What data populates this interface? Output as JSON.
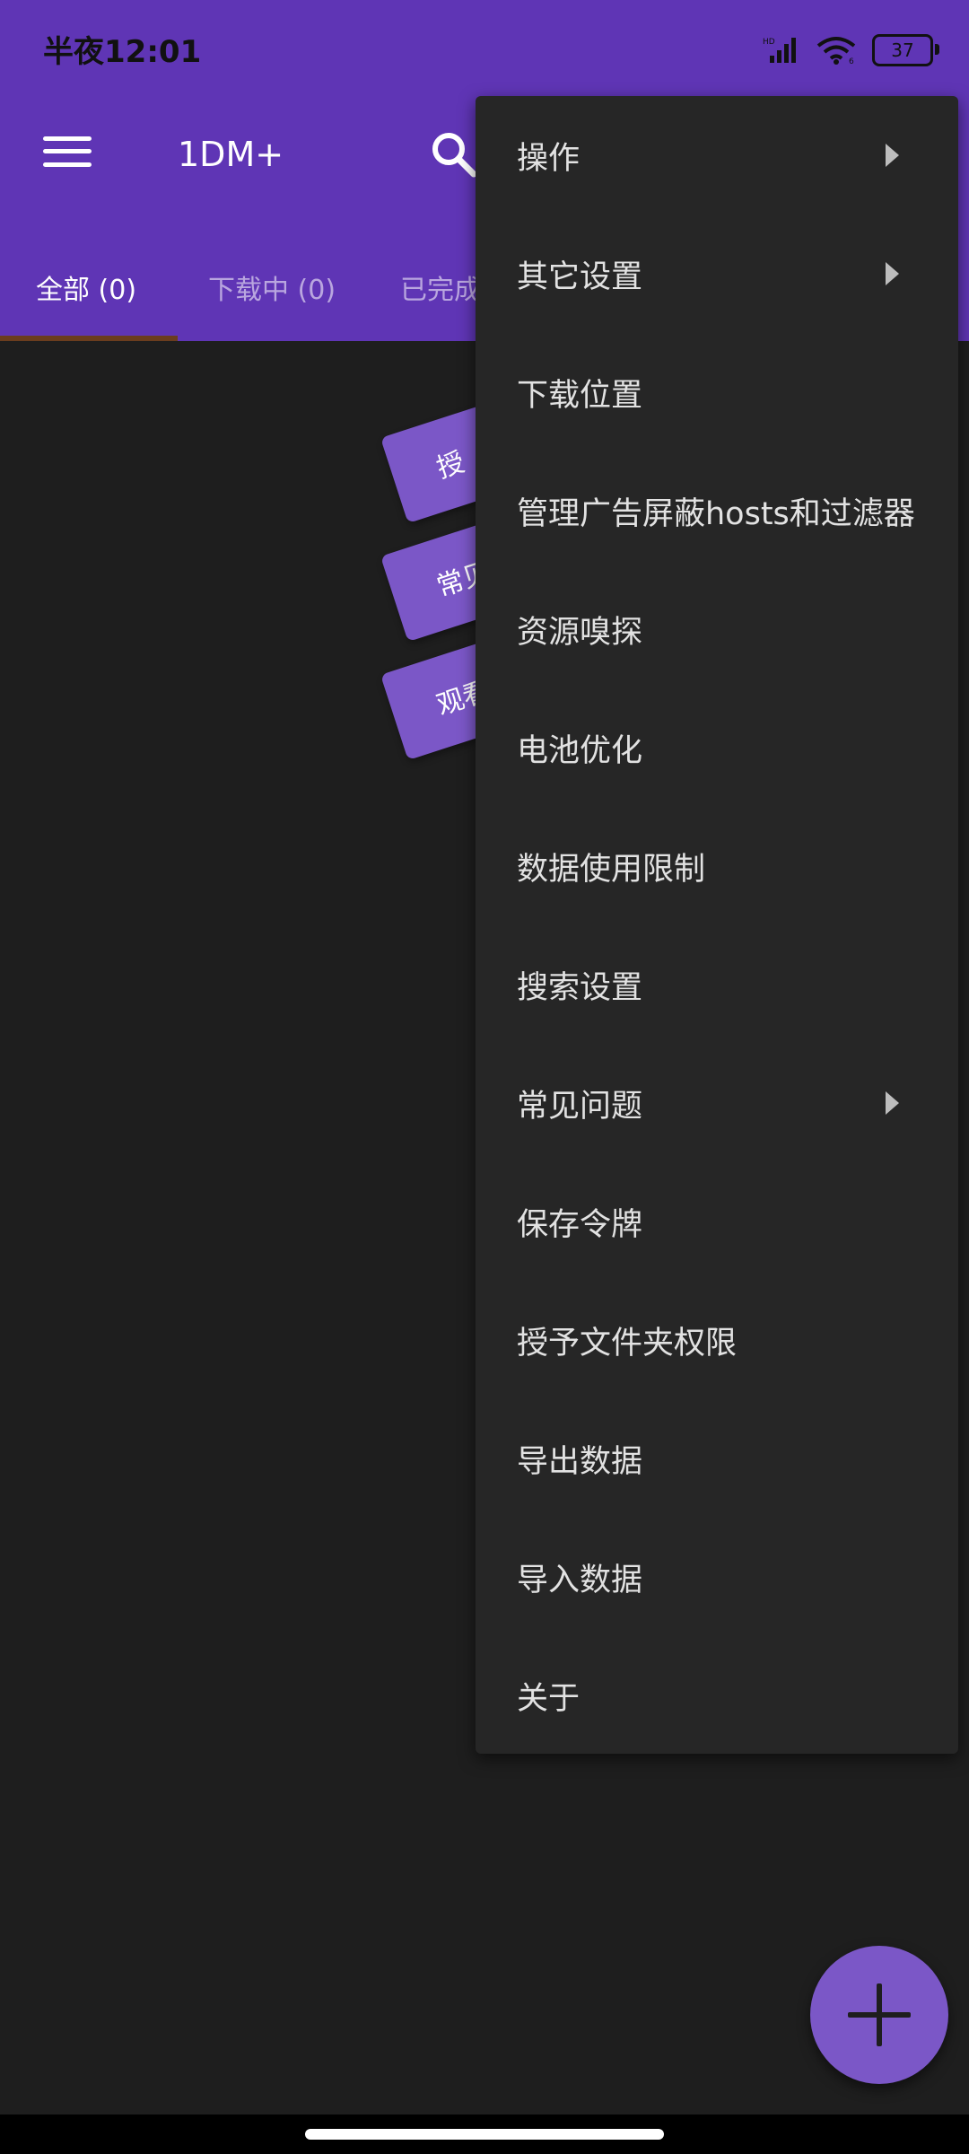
{
  "status_bar": {
    "time": "半夜12:01",
    "battery_level": "37",
    "icons": [
      "hd-signal-icon",
      "wifi-icon",
      "battery-icon"
    ]
  },
  "toolbar": {
    "app_title": "1DM+",
    "menu_icon": "hamburger-icon",
    "search_icon": "search-icon"
  },
  "tabs": [
    {
      "label": "全部 (0)"
    },
    {
      "label": "下载中 (0)"
    },
    {
      "label": "已完成"
    }
  ],
  "tips": [
    {
      "label": "授"
    },
    {
      "label": "常见"
    },
    {
      "label": "观看"
    }
  ],
  "overflow_menu": {
    "items": [
      {
        "label": "操作",
        "has_submenu": true
      },
      {
        "label": "其它设置",
        "has_submenu": true
      },
      {
        "label": "下载位置",
        "has_submenu": false
      },
      {
        "label": "管理广告屏蔽hosts和过滤器",
        "has_submenu": false
      },
      {
        "label": "资源嗅探",
        "has_submenu": false
      },
      {
        "label": "电池优化",
        "has_submenu": false
      },
      {
        "label": "数据使用限制",
        "has_submenu": false
      },
      {
        "label": "搜索设置",
        "has_submenu": false
      },
      {
        "label": "常见问题",
        "has_submenu": true
      },
      {
        "label": "保存令牌",
        "has_submenu": false
      },
      {
        "label": "授予文件夹权限",
        "has_submenu": false
      },
      {
        "label": "导出数据",
        "has_submenu": false
      },
      {
        "label": "导入数据",
        "has_submenu": false
      },
      {
        "label": "关于",
        "has_submenu": false
      }
    ]
  },
  "fab": {
    "icon": "plus-icon"
  },
  "colors": {
    "primary": "#5f35b5",
    "accent": "#7b57c7",
    "background": "#1e1e1e",
    "menu_background": "#262626"
  }
}
